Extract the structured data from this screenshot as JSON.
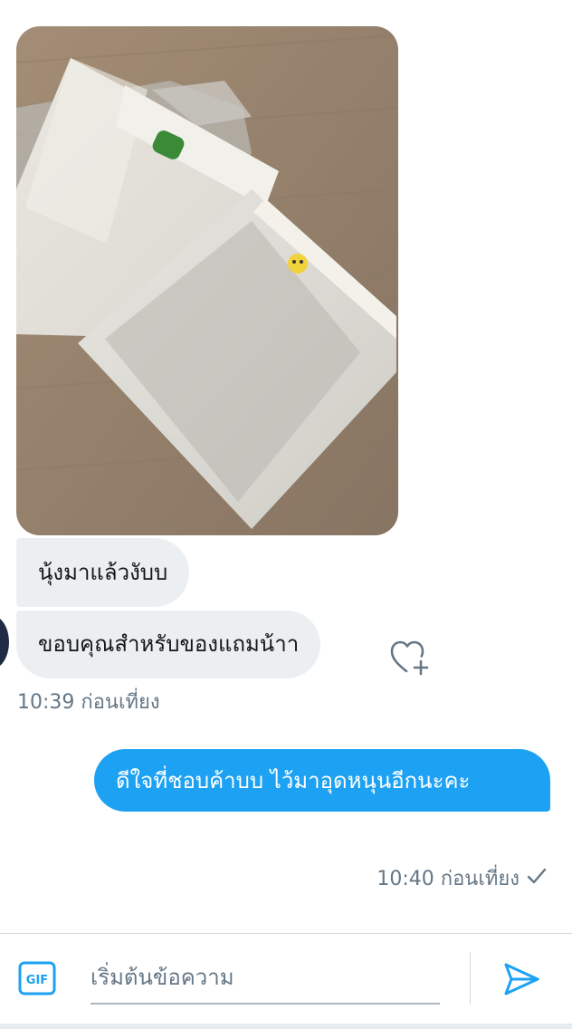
{
  "conversation": {
    "image_alt": "photo",
    "received_messages": [
      {
        "text": "นุ้งมาแล้วงับบ"
      },
      {
        "text": "ขอบคุณสำหรับของแถมน้าา"
      }
    ],
    "received_time": "10:39 ก่อนเที่ยง",
    "sent_message": "ดีใจที่ชอบค้าบบ ไว้มาอุดหนุนอีกนะคะ",
    "sent_time": "10:40 ก่อนเที่ยง"
  },
  "icons": {
    "like": "heart-plus-icon",
    "read_status": "check-icon",
    "gif": "gif-icon",
    "send": "send-icon"
  },
  "composer": {
    "gif_label": "GIF",
    "placeholder": "เริ่มต้นข้อความ"
  },
  "colors": {
    "accent": "#1da1f2",
    "incoming_bubble": "#eceff1",
    "muted_text": "#657786"
  }
}
